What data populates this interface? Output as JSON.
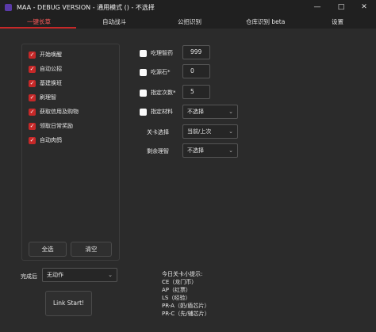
{
  "window": {
    "title": "MAA - DEBUG VERSION - 通用模式 () - 不选择",
    "minimize_icon": "minimize-icon",
    "maximize_icon": "maximize-icon",
    "close_icon": "close-icon"
  },
  "tabs": [
    {
      "label": "一键长草"
    },
    {
      "label": "自动战斗"
    },
    {
      "label": "公招识别"
    },
    {
      "label": "仓库识别 beta"
    },
    {
      "label": "设置"
    }
  ],
  "tasks": [
    {
      "label": "开始唤醒",
      "checked": true
    },
    {
      "label": "自动公招",
      "checked": true
    },
    {
      "label": "基建换班",
      "checked": true
    },
    {
      "label": "刷理智",
      "checked": true
    },
    {
      "label": "获取信用及购物",
      "checked": true
    },
    {
      "label": "领取日常奖励",
      "checked": true
    },
    {
      "label": "自动肉鸽",
      "checked": true
    }
  ],
  "buttons": {
    "select_all": "全选",
    "clear": "清空",
    "link_start": "Link Start!"
  },
  "after_completion": {
    "label": "完成后",
    "value": "无动作"
  },
  "options": {
    "medicine": {
      "label": "吃理智药",
      "value": "999"
    },
    "stone": {
      "label": "吃源石*",
      "value": "0"
    },
    "times": {
      "label": "指定次数*",
      "value": "5"
    },
    "material": {
      "label": "指定材料",
      "value": "不选择"
    },
    "stage": {
      "label": "关卡选择",
      "value": "当前/上次"
    },
    "remaining": {
      "label": "剩余理智",
      "value": "不选择"
    }
  },
  "hints": {
    "title": "今日关卡小提示:",
    "lines": [
      "CE（龙门币）",
      "AP（红票）",
      "LS（经验）",
      "PR-A（奶/盾芯片）",
      "PR-C（先/辅芯片）"
    ]
  },
  "colors": {
    "accent": "#c62828",
    "active_tab_text": "#ff5b5b",
    "background": "#2b2b2b"
  }
}
